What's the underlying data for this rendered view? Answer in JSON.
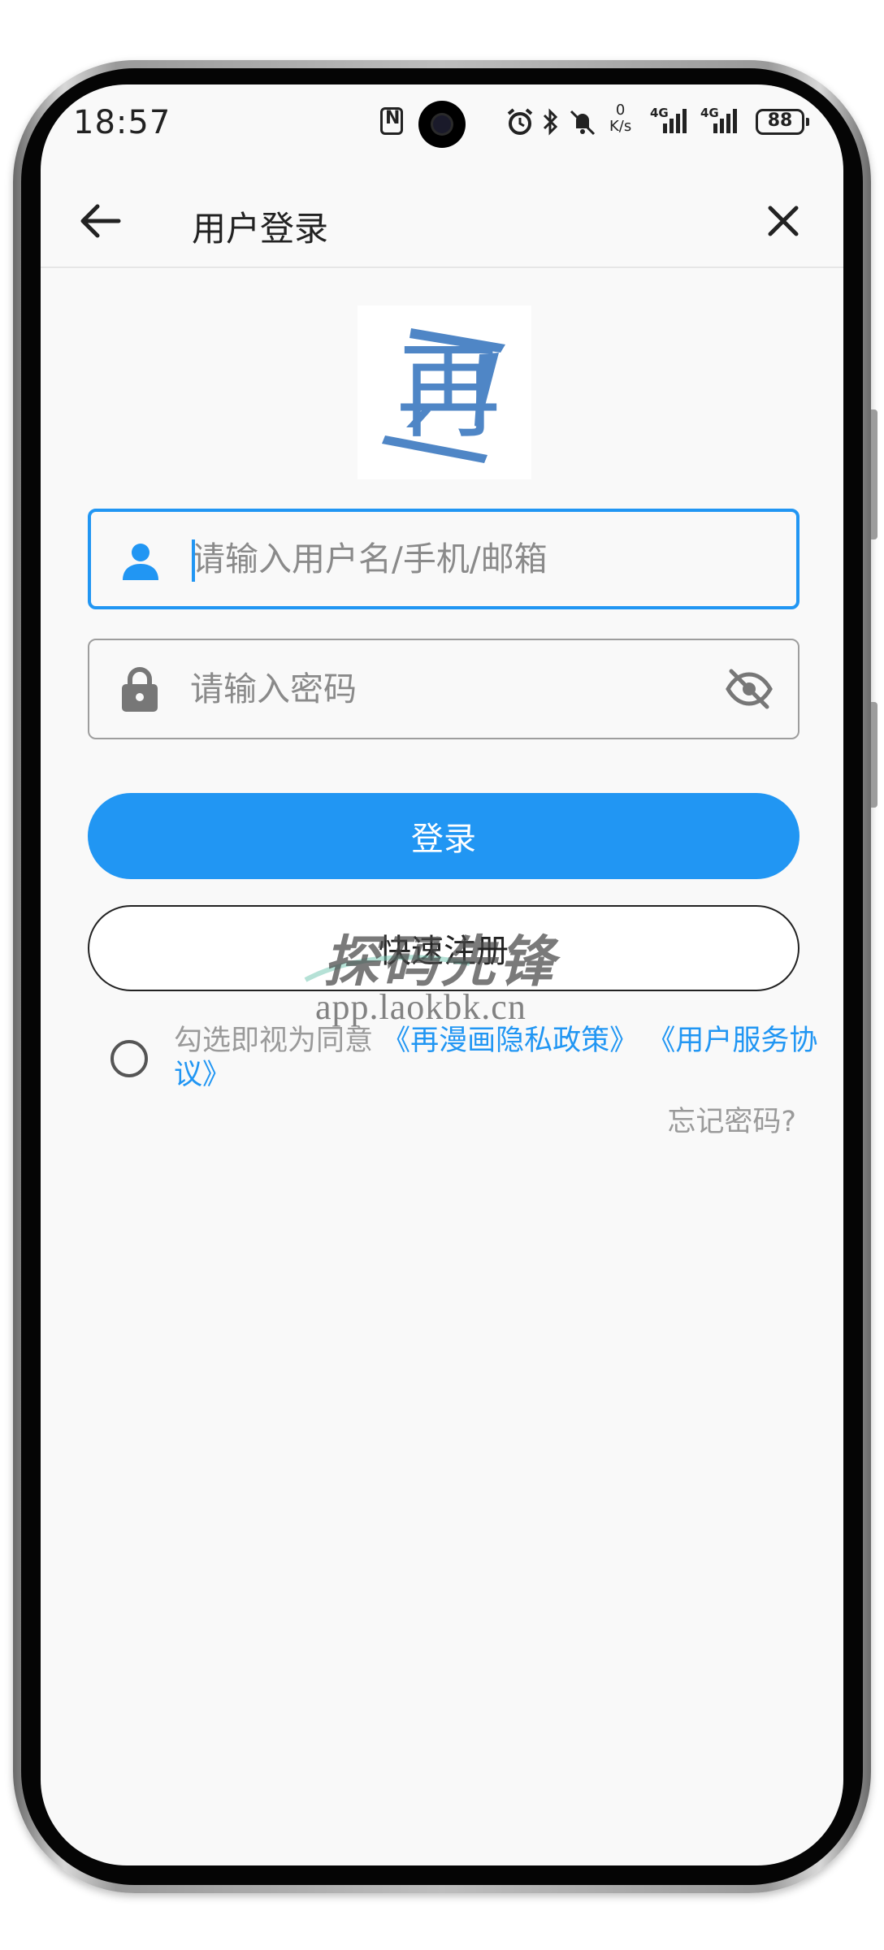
{
  "status_bar": {
    "time": "18:57",
    "net_speed_value": "0",
    "net_speed_unit": "K/s",
    "signal1_label": "4G",
    "signal2_label": "4G",
    "battery": "88"
  },
  "header": {
    "title": "用户登录"
  },
  "login_form": {
    "username_placeholder": "请输入用户名/手机/邮箱",
    "username_value": "",
    "password_placeholder": "请输入密码",
    "password_value": "",
    "login_label": "登录",
    "register_label": "快速注册"
  },
  "agreement": {
    "prefix": "勾选即视为同意",
    "privacy_link": "《再漫画隐私政策》",
    "terms_link": "《用户服务协议》",
    "checked": false
  },
  "forgot_password": "忘记密码?",
  "logo": {
    "char": "再",
    "color": "#4f86c6"
  },
  "watermark": {
    "title": "探码先锋",
    "url": "app.laokbk.cn"
  },
  "colors": {
    "accent": "#2196f3",
    "background": "#f9f9f9"
  }
}
